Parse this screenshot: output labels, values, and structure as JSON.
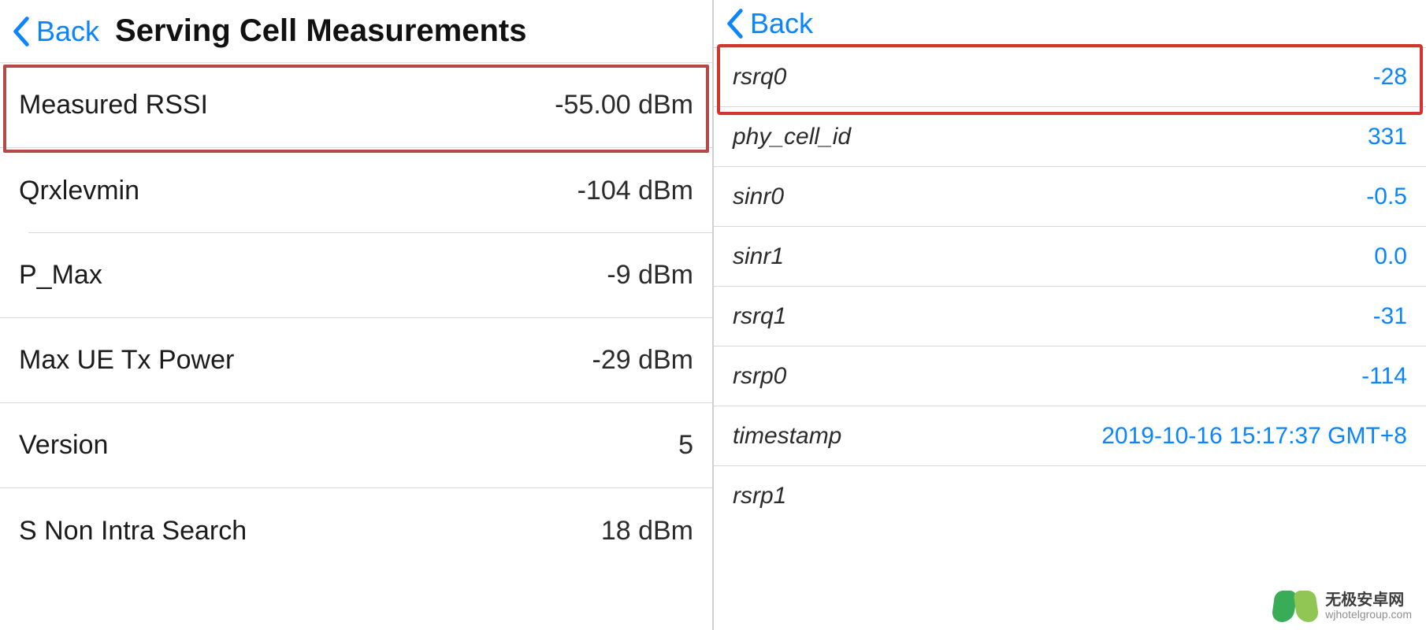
{
  "left": {
    "back": "Back",
    "title": "Serving Cell Measurements",
    "rows": [
      {
        "label": "Measured RSSI",
        "value": "-55.00 dBm"
      },
      {
        "label": "Qrxlevmin",
        "value": "-104 dBm"
      },
      {
        "label": "P_Max",
        "value": "-9 dBm"
      },
      {
        "label": "Max UE Tx Power",
        "value": "-29 dBm"
      },
      {
        "label": "Version",
        "value": "5"
      },
      {
        "label": "S Non Intra Search",
        "value": "18 dBm"
      }
    ]
  },
  "right": {
    "back": "Back",
    "rows": [
      {
        "label": "rsrq0",
        "value": "-28"
      },
      {
        "label": "phy_cell_id",
        "value": "331"
      },
      {
        "label": "sinr0",
        "value": "-0.5"
      },
      {
        "label": "sinr1",
        "value": "0.0"
      },
      {
        "label": "rsrq1",
        "value": "-31"
      },
      {
        "label": "rsrp0",
        "value": "-114"
      },
      {
        "label": "timestamp",
        "value": "2019-10-16 15:17:37 GMT+8"
      },
      {
        "label": "rsrp1",
        "value": ""
      }
    ]
  },
  "watermark": {
    "line1": "无极安卓网",
    "line2": "wjhotelgroup.com"
  }
}
